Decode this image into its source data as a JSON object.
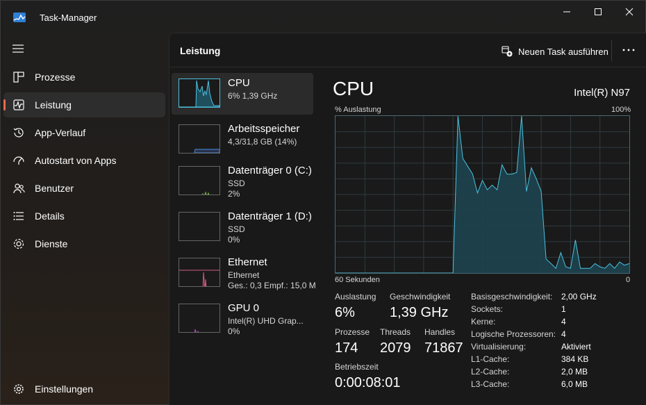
{
  "window": {
    "title": "Task-Manager"
  },
  "sidebar": {
    "items": [
      {
        "label": "Prozesse",
        "icon": "processes-icon"
      },
      {
        "label": "Leistung",
        "icon": "performance-icon",
        "active": true
      },
      {
        "label": "App-Verlauf",
        "icon": "history-icon"
      },
      {
        "label": "Autostart von Apps",
        "icon": "startup-icon"
      },
      {
        "label": "Benutzer",
        "icon": "users-icon"
      },
      {
        "label": "Details",
        "icon": "details-icon"
      },
      {
        "label": "Dienste",
        "icon": "services-icon"
      }
    ],
    "settings_label": "Einstellungen"
  },
  "header": {
    "title": "Leistung",
    "new_task_label": "Neuen Task ausführen"
  },
  "resources": [
    {
      "name": "CPU",
      "line1": "6%  1,39 GHz",
      "line2": ""
    },
    {
      "name": "Arbeitsspeicher",
      "line1": "4,3/31,8 GB (14%)",
      "line2": ""
    },
    {
      "name": "Datenträger 0 (C:)",
      "line1": "SSD",
      "line2": "2%"
    },
    {
      "name": "Datenträger 1 (D:)",
      "line1": "SSD",
      "line2": "0%"
    },
    {
      "name": "Ethernet",
      "line1": "Ethernet",
      "line2": "Ges.: 0,3  Empf.: 15,0 MB"
    },
    {
      "name": "GPU 0",
      "line1": "Intel(R) UHD Grap...",
      "line2": "0%"
    }
  ],
  "detail": {
    "title": "CPU",
    "model": "Intel(R) N97",
    "graph_label_left": "% Auslastung",
    "graph_label_right": "100%",
    "graph_axis_left": "60 Sekunden",
    "graph_axis_right": "0",
    "graph_color": "#4cc2e0",
    "stats": {
      "auslastung_label": "Auslastung",
      "auslastung_value": "6%",
      "geschwindigkeit_label": "Geschwindigkeit",
      "geschwindigkeit_value": "1,39 GHz",
      "prozesse_label": "Prozesse",
      "prozesse_value": "174",
      "threads_label": "Threads",
      "threads_value": "2079",
      "handles_label": "Handles",
      "handles_value": "71867",
      "betriebszeit_label": "Betriebszeit",
      "betriebszeit_value": "0:00:08:01"
    },
    "specs": [
      {
        "label": "Basisgeschwindigkeit:",
        "value": "2,00 GHz"
      },
      {
        "label": "Sockets:",
        "value": "1"
      },
      {
        "label": "Kerne:",
        "value": "4"
      },
      {
        "label": "Logische Prozessoren:",
        "value": "4"
      },
      {
        "label": "Virtualisierung:",
        "value": "Aktiviert"
      },
      {
        "label": "L1-Cache:",
        "value": "384 KB"
      },
      {
        "label": "L2-Cache:",
        "value": "2,0 MB"
      },
      {
        "label": "L3-Cache:",
        "value": "6,0 MB"
      }
    ]
  },
  "chart_data": {
    "type": "area",
    "title": "",
    "xlabel": "60 Sekunden",
    "ylabel": "% Auslastung",
    "ylim": [
      0,
      100
    ],
    "xlim": [
      60,
      0
    ],
    "x": [
      60,
      59,
      58,
      57,
      56,
      55,
      54,
      53,
      52,
      51,
      50,
      49,
      48,
      47,
      46,
      45,
      44,
      43,
      42,
      41,
      40,
      39,
      38,
      37,
      36,
      35,
      34,
      33,
      32,
      31,
      30,
      29,
      28,
      27,
      26,
      25,
      24,
      23,
      22,
      21,
      20,
      19,
      18,
      17,
      16,
      15,
      14,
      13,
      12,
      11,
      10,
      9,
      8,
      7,
      6,
      5,
      4,
      3,
      2,
      1,
      0
    ],
    "series": [
      {
        "values": [
          0,
          0,
          0,
          0,
          0,
          0,
          0,
          0,
          0,
          0,
          0,
          0,
          0,
          0,
          0,
          0,
          0,
          0,
          0,
          0,
          0,
          0,
          0,
          0,
          0,
          100,
          73,
          68,
          63,
          51,
          59,
          53,
          56,
          53,
          69,
          63,
          63,
          64,
          100,
          52,
          67,
          60,
          52,
          9,
          6,
          3,
          13,
          4,
          3,
          21,
          3,
          3,
          3,
          6,
          4,
          3,
          6,
          3,
          7,
          5,
          6
        ]
      }
    ]
  }
}
